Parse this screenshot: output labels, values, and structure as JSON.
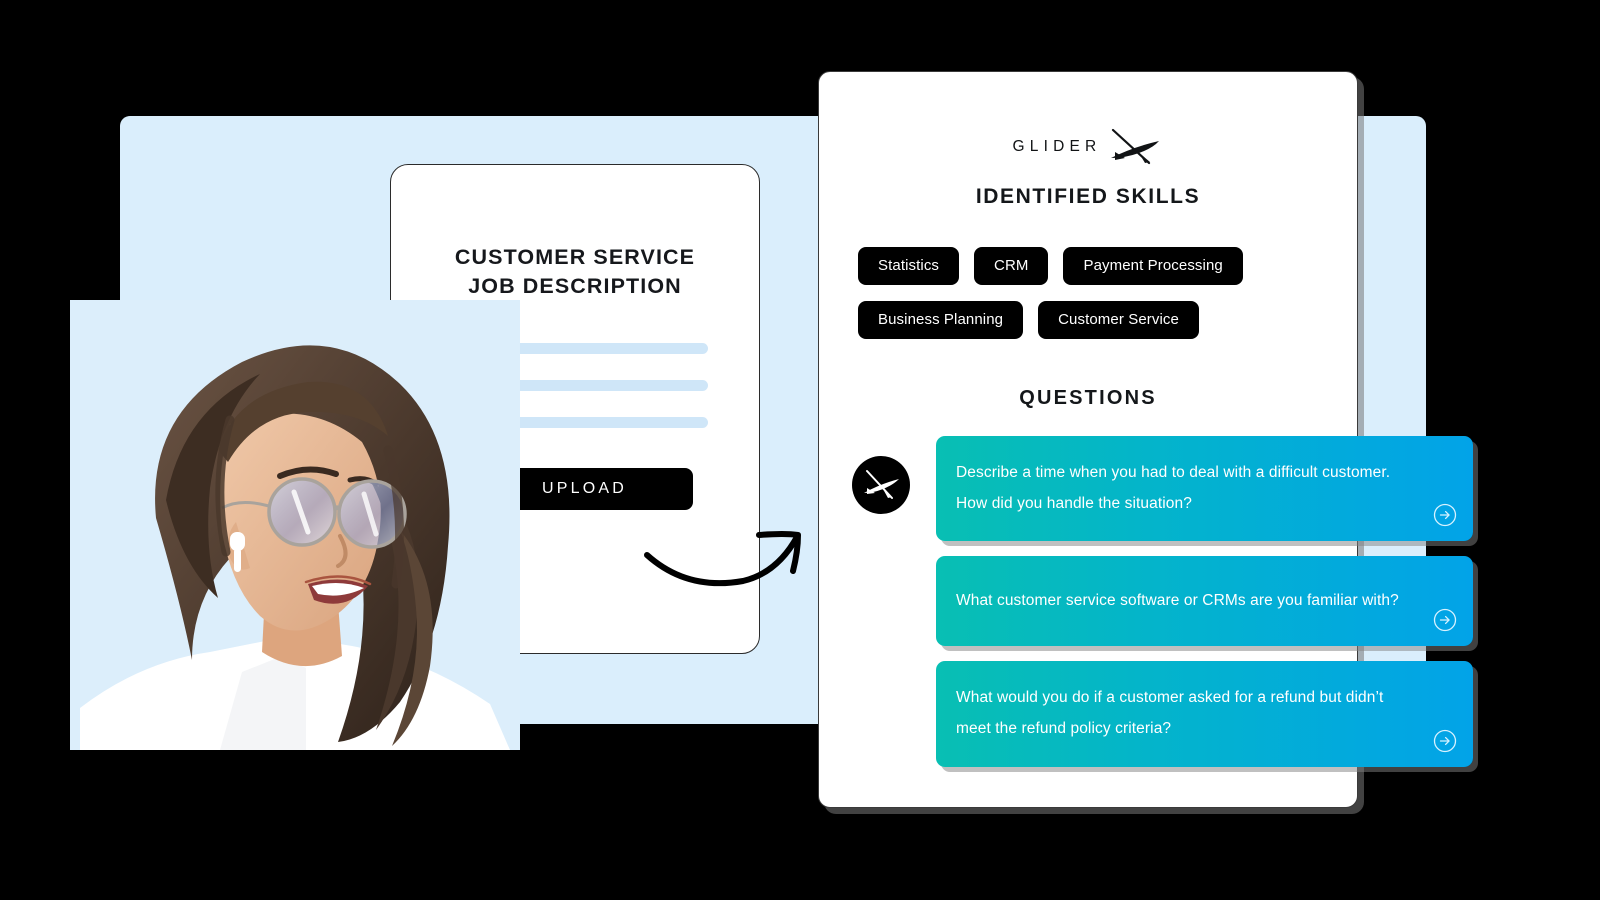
{
  "brand": {
    "name": "GLIDER",
    "logo_icon": "glider-plane-icon",
    "avatar_icon": "glider-plane-avatar-icon"
  },
  "colors": {
    "backdrop_panel": "#daeefc",
    "placeholder_line": "#cfe6f8",
    "pill_background": "#000000",
    "question_gradient_start": "#08bfb3",
    "question_gradient_end": "#02a3e8",
    "page_background": "#000000"
  },
  "job_description": {
    "title_line1": "CUSTOMER SERVICE",
    "title_line2": "JOB DESCRIPTION",
    "placeholder_lines": 3,
    "upload_label": "UPLOAD"
  },
  "connector": {
    "icon": "curved-arrow-icon"
  },
  "results": {
    "skills_heading": "IDENTIFIED SKILLS",
    "skills": [
      "Statistics",
      "CRM",
      "Payment Processing",
      "Business Planning",
      "Customer Service"
    ],
    "questions_heading": "QUESTIONS",
    "questions": [
      {
        "line1": "Describe a time when you had to deal with a difficult customer.",
        "line2": "How did you handle the situation?",
        "go_icon": "arrow-right-circle-icon"
      },
      {
        "line1": "What customer service software or CRMs are you familiar with?",
        "line2": "",
        "go_icon": "arrow-right-circle-icon"
      },
      {
        "line1": "What would you do if a customer asked for a refund but didn’t",
        "line2": " meet the refund policy criteria?",
        "go_icon": "arrow-right-circle-icon"
      }
    ]
  },
  "photo": {
    "alt": "smiling-woman-with-glasses-and-earbud"
  }
}
